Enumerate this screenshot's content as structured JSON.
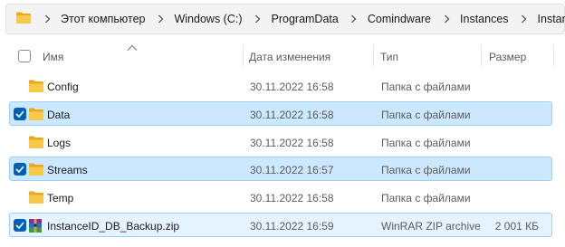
{
  "address": {
    "crumbs": [
      "Этот компьютер",
      "Windows (C:)",
      "ProgramData",
      "Comindware",
      "Instances",
      "InstanceID"
    ]
  },
  "columns": {
    "name": "Имя",
    "date": "Дата изменения",
    "type": "Тип",
    "size": "Размер"
  },
  "files": [
    {
      "name": "Config",
      "date": "30.11.2022 16:58",
      "type": "Папка с файлами",
      "size": "",
      "kind": "folder-icon",
      "checked": false
    },
    {
      "name": "Data",
      "date": "30.11.2022 16:58",
      "type": "Папка с файлами",
      "size": "",
      "kind": "folder-icon",
      "checked": true
    },
    {
      "name": "Logs",
      "date": "30.11.2022 16:58",
      "type": "Папка с файлами",
      "size": "",
      "kind": "folder-icon",
      "checked": false
    },
    {
      "name": "Streams",
      "date": "30.11.2022 16:57",
      "type": "Папка с файлами",
      "size": "",
      "kind": "folder-icon",
      "checked": true
    },
    {
      "name": "Temp",
      "date": "30.11.2022 16:58",
      "type": "Папка с файлами",
      "size": "",
      "kind": "folder-icon",
      "checked": false
    },
    {
      "name": "InstanceID_DB_Backup.zip",
      "date": "30.11.2022 16:59",
      "type": "WinRAR ZIP archive",
      "size": "2 001 КБ",
      "kind": "winrar-archive-icon",
      "checked": true
    }
  ],
  "colors": {
    "selected_bg": "#cce8ff",
    "selected_border": "#99d1ff",
    "checkbox_accent": "#005fb8",
    "folder_yellow": "#f8c848"
  }
}
